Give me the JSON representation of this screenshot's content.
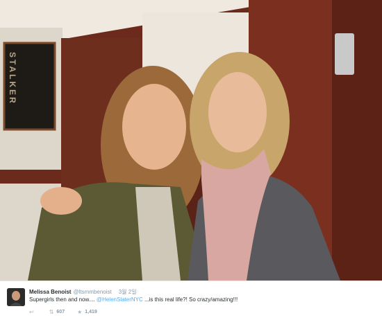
{
  "photo": {
    "poster_text": "STALKER",
    "colors": {
      "wall_wood": "#6b2a1c",
      "wall_white": "#e8e2d8"
    }
  },
  "tweet": {
    "author_name": "Melissa Benoist",
    "author_handle": "@ltsmmbenoist",
    "timestamp": "3월 2일",
    "text_before": "Supergirls then and now.... ",
    "mention": "@HelenSlaterNYC",
    "text_after": " ...is this real life?! So crazy/amazing!!!",
    "retweet_count": "607",
    "favorite_count": "1,419",
    "icons": {
      "reply": "reply-icon",
      "retweet": "retweet-icon",
      "favorite": "star-icon"
    },
    "colors": {
      "link": "#55acee",
      "text": "#292f33",
      "muted": "#8899a6"
    }
  }
}
